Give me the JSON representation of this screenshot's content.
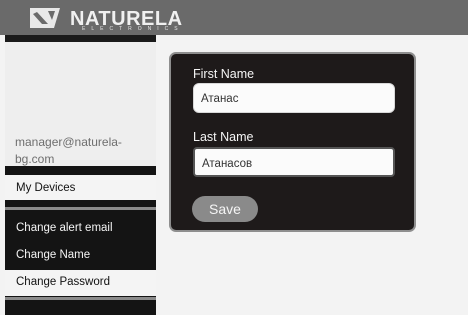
{
  "header": {
    "brand": "NATURELA",
    "brand_sub": "ELECTRONICS"
  },
  "sidebar": {
    "email": "manager@naturela-bg.com",
    "my_devices": "My Devices",
    "items": [
      {
        "label": "Change alert email"
      },
      {
        "label": "Change Name"
      },
      {
        "label": "Change Password"
      }
    ]
  },
  "form": {
    "first_name_label": "First Name",
    "first_name_value": "Атанас",
    "last_name_label": "Last Name",
    "last_name_value": "Атанасов",
    "save_label": "Save"
  },
  "colors": {
    "header_bg": "#6a6a6a",
    "sidebar_bg": "#141414",
    "panel_bg": "#1e1a1a",
    "button_bg": "#8a8a8a"
  }
}
